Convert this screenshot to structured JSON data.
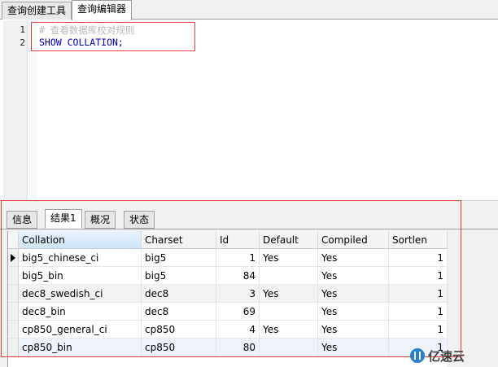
{
  "top_tabs": [
    {
      "label": "查询创建工具",
      "active": false
    },
    {
      "label": "查询编辑器",
      "active": true
    }
  ],
  "editor": {
    "lines": [
      {
        "number": "1",
        "text": "# 查看数据库校对规则"
      },
      {
        "number": "2",
        "text": "SHOW COLLATION;"
      }
    ]
  },
  "result_tabs": [
    {
      "label": "信息",
      "active": false
    },
    {
      "label": "结果1",
      "active": true
    },
    {
      "label": "概况",
      "active": false
    },
    {
      "label": "状态",
      "active": false
    }
  ],
  "grid": {
    "columns": [
      "Collation",
      "Charset",
      "Id",
      "Default",
      "Compiled",
      "Sortlen"
    ],
    "rows": [
      [
        "big5_chinese_ci",
        "big5",
        "1",
        "Yes",
        "Yes",
        "1"
      ],
      [
        "big5_bin",
        "big5",
        "84",
        "",
        "Yes",
        "1"
      ],
      [
        "dec8_swedish_ci",
        "dec8",
        "3",
        "Yes",
        "Yes",
        "1"
      ],
      [
        "dec8_bin",
        "dec8",
        "69",
        "",
        "Yes",
        "1"
      ],
      [
        "cp850_general_ci",
        "cp850",
        "4",
        "Yes",
        "Yes",
        "1"
      ],
      [
        "cp850_bin",
        "cp850",
        "80",
        "",
        "Yes",
        "1"
      ]
    ]
  },
  "watermark": {
    "text": "亿速云"
  },
  "colors": {
    "annotation_box": "#e04040",
    "keyword": "#0000c0",
    "comment": "#b8b8b8"
  }
}
